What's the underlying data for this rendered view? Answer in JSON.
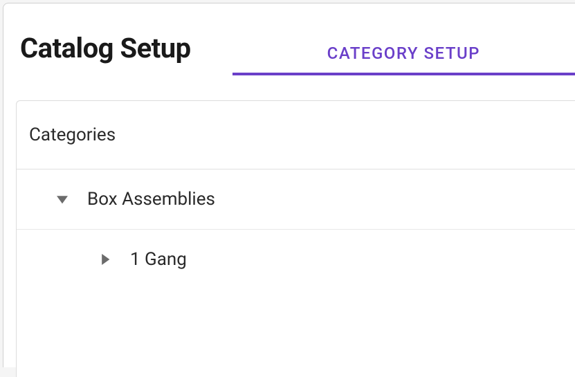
{
  "header": {
    "title": "Catalog Setup"
  },
  "tabs": {
    "active": "CATEGORY SETUP"
  },
  "panel": {
    "header": "Categories",
    "tree": [
      {
        "label": "Box Assemblies",
        "expanded": true,
        "level": 0
      },
      {
        "label": "1 Gang",
        "expanded": false,
        "level": 1
      }
    ]
  }
}
